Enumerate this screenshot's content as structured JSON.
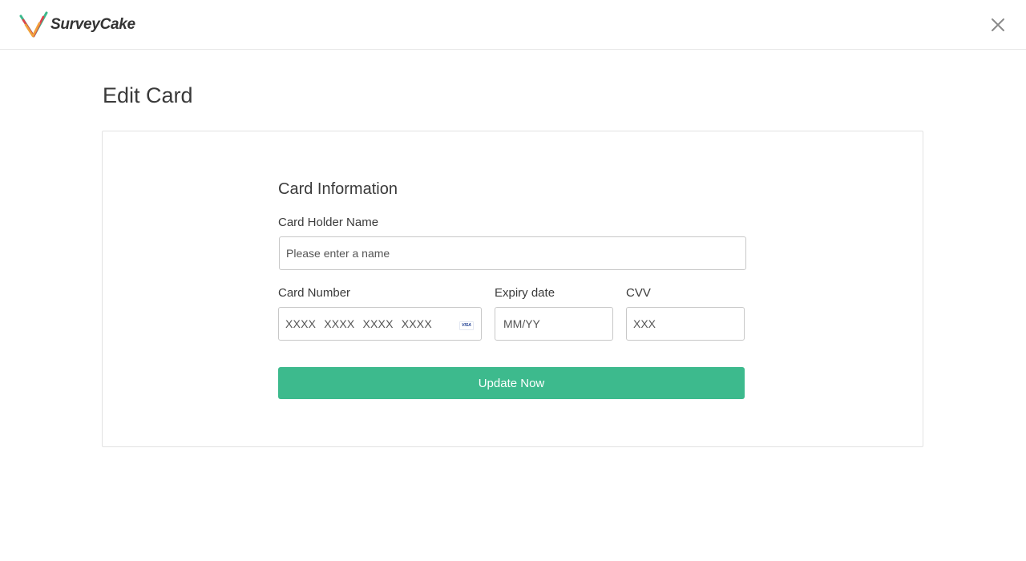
{
  "brand": {
    "name": "SurveyCake",
    "colors": {
      "teal": "#3dba8d",
      "red": "#e0424b",
      "orange": "#f0a23c"
    }
  },
  "header": {
    "close_icon": "close-icon"
  },
  "page": {
    "title": "Edit Card"
  },
  "form": {
    "section_title": "Card Information",
    "holder_name": {
      "label": "Card Holder Name",
      "placeholder": "Please enter a name",
      "value": ""
    },
    "card_number": {
      "label": "Card Number",
      "placeholder": "XXXX XXXX XXXX XXXX",
      "value": "",
      "brand_icon": "visa-icon",
      "brand_text": "VISA"
    },
    "expiry": {
      "label": "Expiry date",
      "placeholder": "MM/YY",
      "value": ""
    },
    "cvv": {
      "label": "CVV",
      "placeholder": "XXX",
      "value": ""
    },
    "submit_label": "Update Now"
  },
  "colors": {
    "accent": "#3dba8d",
    "border": "#c8c8c8",
    "panel_border": "#e2e2e2",
    "text": "#3a3a3a"
  }
}
